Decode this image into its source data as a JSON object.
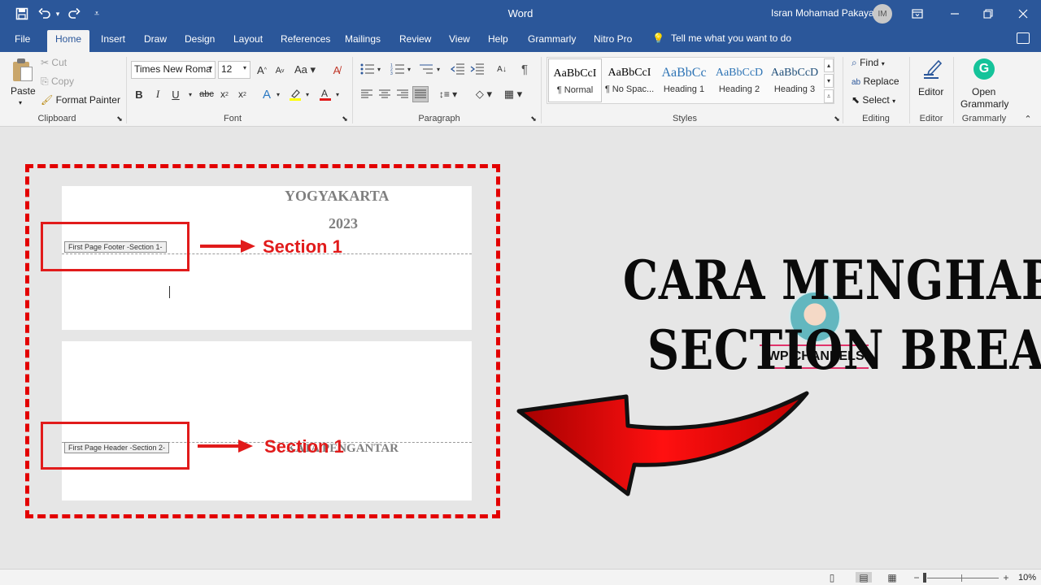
{
  "titlebar": {
    "app_title": "Word",
    "user_name": "Isran Mohamad Pakaya",
    "user_initials": "IM",
    "save_icon": "save-icon",
    "undo_icon": "undo-icon",
    "redo_icon": "redo-icon",
    "customize_icon": "customize-qat-icon"
  },
  "tabs": [
    {
      "label": "File"
    },
    {
      "label": "Home"
    },
    {
      "label": "Insert"
    },
    {
      "label": "Draw"
    },
    {
      "label": "Design"
    },
    {
      "label": "Layout"
    },
    {
      "label": "References"
    },
    {
      "label": "Mailings"
    },
    {
      "label": "Review"
    },
    {
      "label": "View"
    },
    {
      "label": "Help"
    },
    {
      "label": "Grammarly"
    },
    {
      "label": "Nitro Pro"
    }
  ],
  "tell_me": "Tell me what you want to do",
  "clipboard": {
    "paste": "Paste",
    "cut": "Cut",
    "copy": "Copy",
    "format_painter": "Format Painter",
    "group_label": "Clipboard"
  },
  "font": {
    "family": "Times New Roma",
    "size": "12",
    "group_label": "Font"
  },
  "paragraph": {
    "group_label": "Paragraph"
  },
  "styles": {
    "group_label": "Styles",
    "items": [
      {
        "preview": "AaBbCcI",
        "name": "¶ Normal"
      },
      {
        "preview": "AaBbCcI",
        "name": "¶ No Spac..."
      },
      {
        "preview": "AaBbCc",
        "name": "Heading 1"
      },
      {
        "preview": "AaBbCcD",
        "name": "Heading 2"
      },
      {
        "preview": "AaBbCcD",
        "name": "Heading 3"
      }
    ]
  },
  "editing": {
    "find": "Find",
    "replace": "Replace",
    "select": "Select",
    "group_label": "Editing"
  },
  "editor": {
    "label": "Editor",
    "group_label": "Editor"
  },
  "grammarly": {
    "label_line1": "Open",
    "label_line2": "Grammarly",
    "group_label": "Grammarly"
  },
  "document": {
    "page1": {
      "line1": "YOGYAKARTA",
      "line2": "2023",
      "footer_tag": "First Page Footer -Section 1-"
    },
    "page2": {
      "header_tag": "First Page Header -Section 2-",
      "heading": "KATA PENGANTAR"
    }
  },
  "annotations": {
    "label1": "Section 1",
    "label2": "Section 1",
    "channel_name": "IWP CHANNELS",
    "title_line1": "CARA MENGHAPUS",
    "title_line2": "SECTION BREAK",
    "accent_color": "#e11b1b"
  },
  "statusbar": {
    "zoom": "10%"
  },
  "colors": {
    "word_blue": "#2b579a",
    "ribbon_bg": "#f3f3f3",
    "canvas_bg": "#e6e6e6"
  }
}
